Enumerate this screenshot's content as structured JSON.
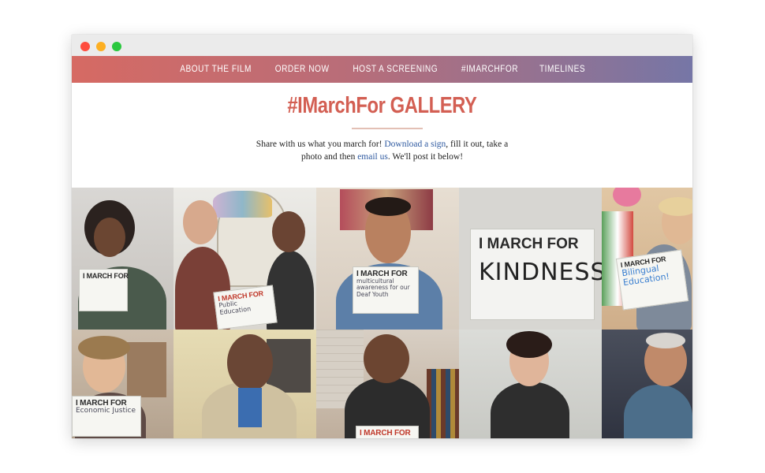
{
  "nav": {
    "items": [
      "ABOUT THE FILM",
      "ORDER NOW",
      "HOST A SCREENING",
      "#IMARCHFOR",
      "TIMELINES"
    ]
  },
  "page": {
    "title": "#IMarchFor GALLERY",
    "intro_prefix": "Share with us what you march for! ",
    "download_link": "Download a sign",
    "intro_middle": ", fill it out, take a photo and then ",
    "email_link": "email us",
    "intro_suffix": ". We'll post it below!"
  },
  "gallery": [
    {
      "sign_header": "I MARCH FOR",
      "sign_text": ""
    },
    {
      "sign_header": "I MARCH FOR",
      "sign_text": "Public Education"
    },
    {
      "sign_header": "I MARCH FOR",
      "sign_text": "multicultural awareness for our Deaf Youth"
    },
    {
      "sign_header": "I MARCH FOR",
      "sign_text": "KINDNESS"
    },
    {
      "sign_header": "I MARCH FOR",
      "sign_text": "Bilingual Education!"
    },
    {
      "sign_header": "I MARCH FOR",
      "sign_text": "Economic Justice"
    },
    {
      "sign_header": "",
      "sign_text": ""
    },
    {
      "sign_header": "I MARCH FOR",
      "sign_text": ""
    },
    {
      "sign_header": "",
      "sign_text": ""
    },
    {
      "sign_header": "",
      "sign_text": ""
    }
  ],
  "colors": {
    "accent": "#d35f53",
    "link": "#2f5aa0",
    "nav_gradient_start": "#d66a63",
    "nav_gradient_end": "#7676a6"
  }
}
